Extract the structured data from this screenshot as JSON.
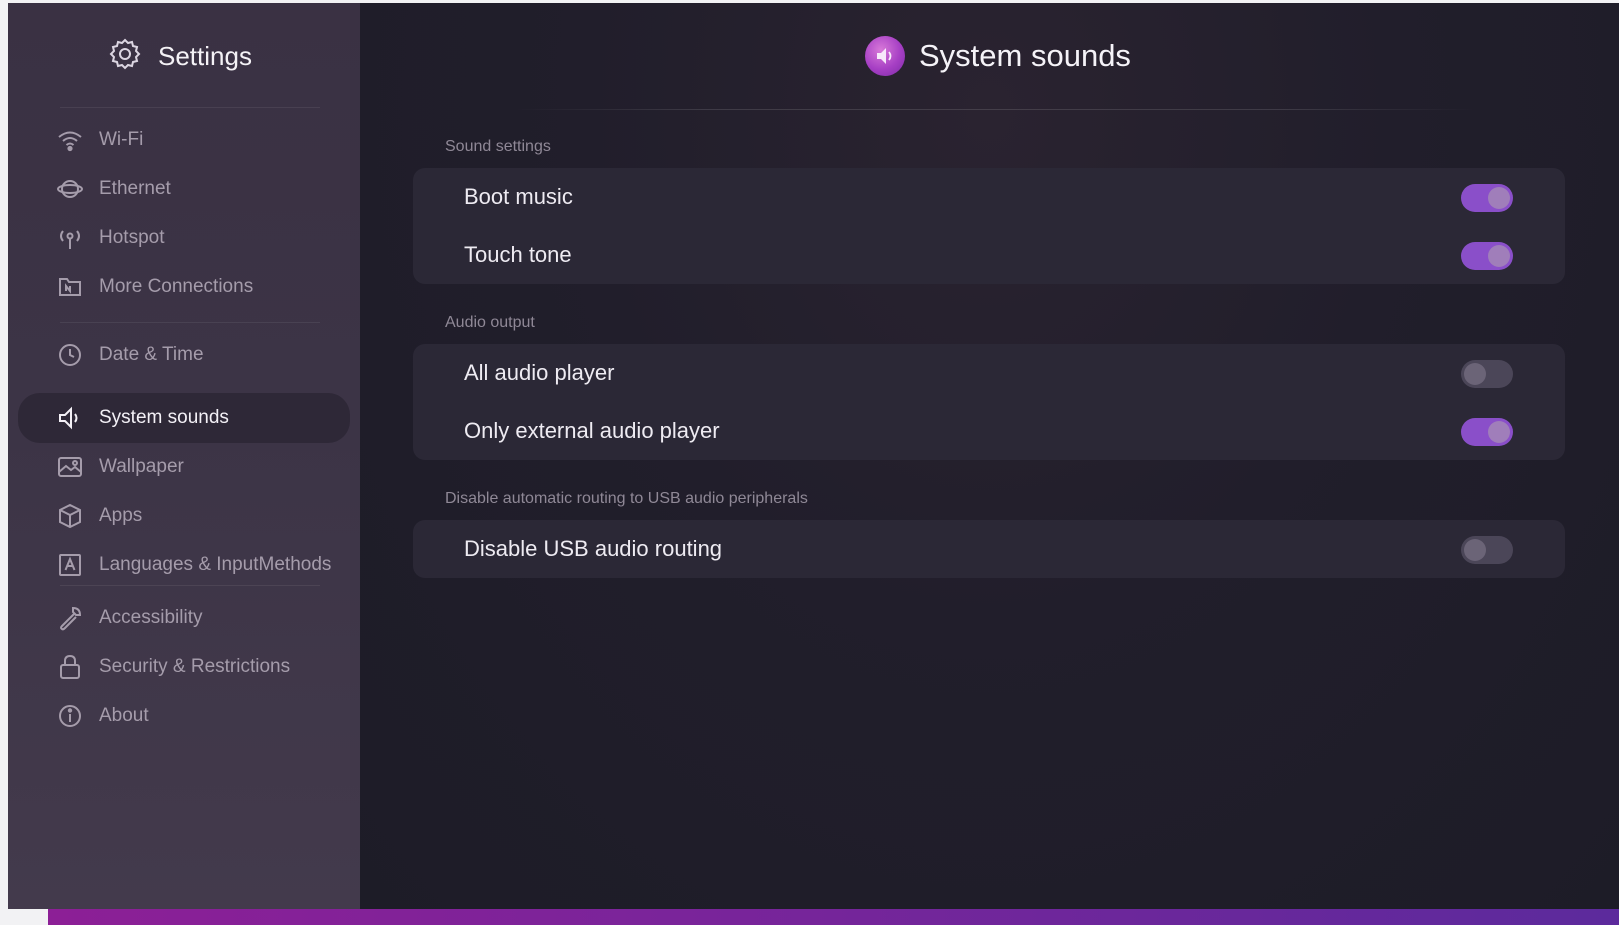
{
  "sidebar": {
    "title": "Settings",
    "items": [
      {
        "label": "Wi-Fi",
        "icon": "wifi-icon"
      },
      {
        "label": "Ethernet",
        "icon": "ethernet-icon"
      },
      {
        "label": "Hotspot",
        "icon": "hotspot-icon"
      },
      {
        "label": "More Connections",
        "icon": "more-connections-icon"
      },
      {
        "label": "Date & Time",
        "icon": "clock-icon"
      },
      {
        "label": "System sounds",
        "icon": "speaker-icon",
        "active": true
      },
      {
        "label": "Wallpaper",
        "icon": "wallpaper-icon"
      },
      {
        "label": "Apps",
        "icon": "apps-cube-icon"
      },
      {
        "label": "Languages & InputMethods",
        "icon": "language-icon"
      },
      {
        "label": "Accessibility",
        "icon": "wrench-icon"
      },
      {
        "label": "Security & Restrictions",
        "icon": "lock-icon"
      },
      {
        "label": "About",
        "icon": "info-icon"
      }
    ]
  },
  "page": {
    "title": "System sounds",
    "icon": "system-sounds-icon"
  },
  "sections": [
    {
      "label": "Sound settings",
      "rows": [
        {
          "label": "Boot music",
          "on": true
        },
        {
          "label": "Touch tone",
          "on": true
        }
      ]
    },
    {
      "label": "Audio output",
      "rows": [
        {
          "label": "All audio player",
          "on": false
        },
        {
          "label": "Only external audio player",
          "on": true
        }
      ]
    },
    {
      "label": "Disable automatic routing to USB audio peripherals",
      "rows": [
        {
          "label": "Disable USB audio routing",
          "on": false
        }
      ]
    }
  ],
  "colors": {
    "accent": "#8a4fc9",
    "sidebar_bg": "#3c3446",
    "main_bg": "#1f1d2a",
    "card_bg": "#2b2836"
  }
}
